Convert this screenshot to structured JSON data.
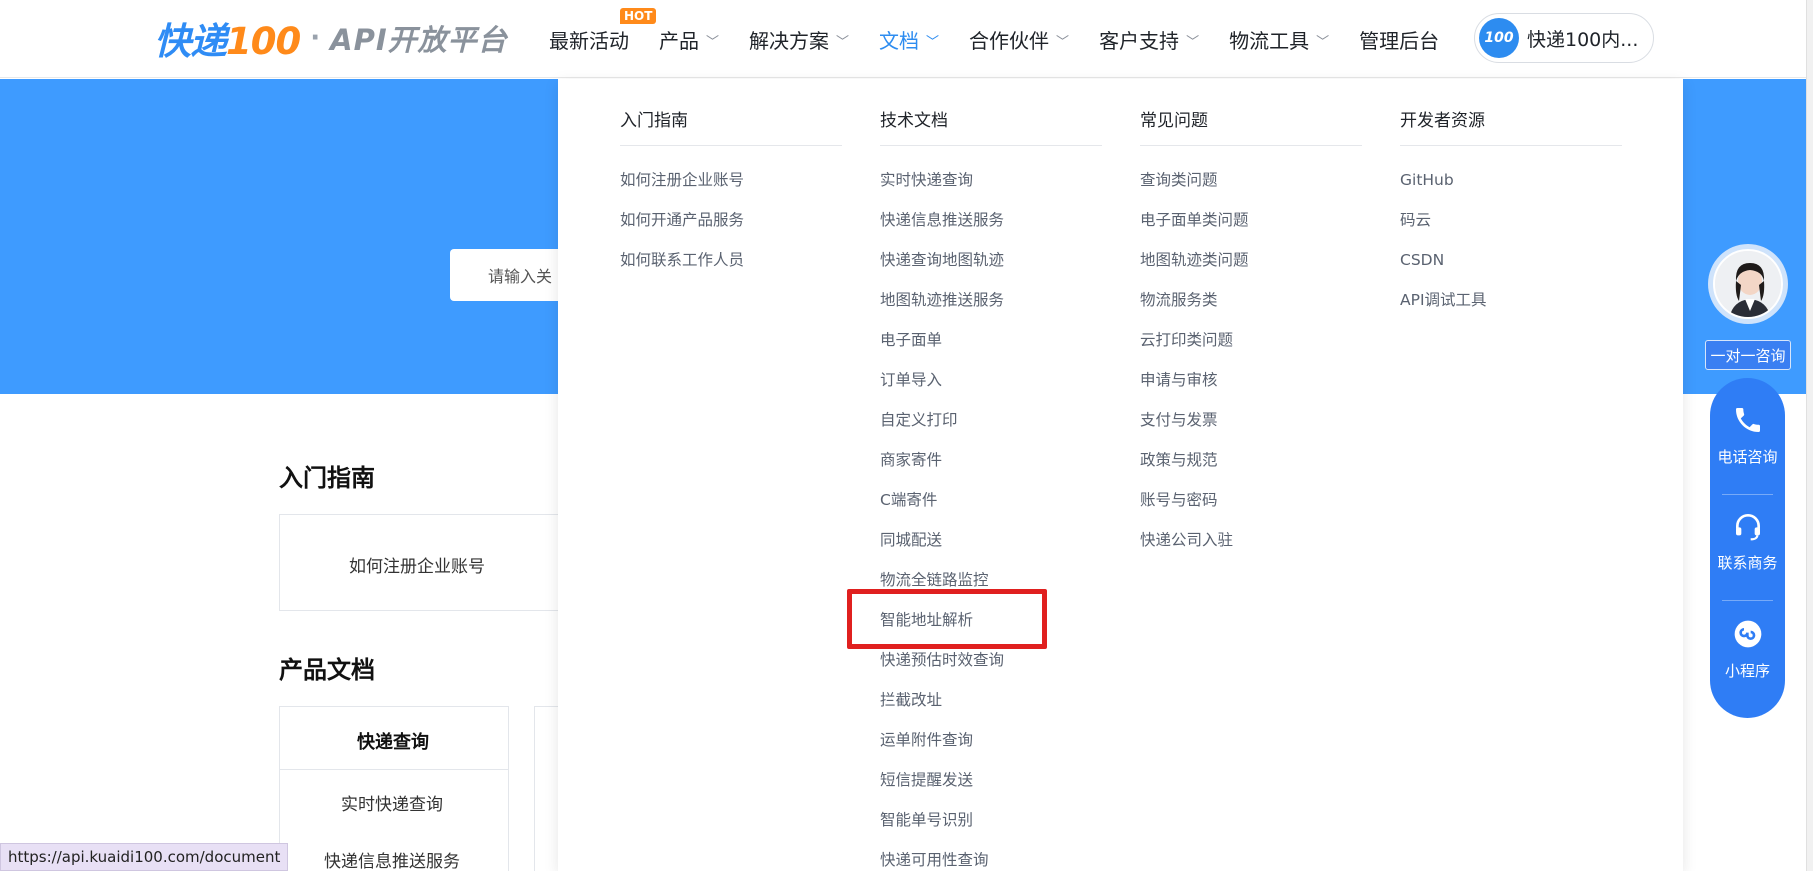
{
  "logo": {
    "brand_text": "快递",
    "brand_num": "100",
    "dot": "·",
    "subtitle": "API开放平台"
  },
  "nav": {
    "items": [
      {
        "label": "最新活动",
        "badge": "HOT"
      },
      {
        "label": "产品"
      },
      {
        "label": "解决方案"
      },
      {
        "label": "文档"
      },
      {
        "label": "合作伙伴"
      },
      {
        "label": "客户支持"
      },
      {
        "label": "物流工具"
      },
      {
        "label": "管理后台"
      }
    ],
    "active_index": 3
  },
  "account": {
    "logo_text": "100",
    "name": "快递100内..."
  },
  "search": {
    "placeholder": "请输入关"
  },
  "sections": {
    "intro_title": "入门指南",
    "intro_card_item": "如何注册企业账号",
    "product_title": "产品文档",
    "table_header": "快递查询",
    "table_rows": [
      "实时快递查询",
      "快递信息推送服务"
    ]
  },
  "status_url": "https://api.kuaidi100.com/document",
  "dropdown": {
    "columns": [
      {
        "title": "入门指南",
        "items": [
          "如何注册企业账号",
          "如何开通产品服务",
          "如何联系工作人员"
        ]
      },
      {
        "title": "技术文档",
        "items": [
          "实时快递查询",
          "快递信息推送服务",
          "快递查询地图轨迹",
          "地图轨迹推送服务",
          "电子面单",
          "订单导入",
          "自定义打印",
          "商家寄件",
          "C端寄件",
          "同城配送",
          "物流全链路监控",
          "智能地址解析",
          "快递预估时效查询",
          "拦截改址",
          "运单附件查询",
          "短信提醒发送",
          "智能单号识别",
          "快递可用性查询"
        ]
      },
      {
        "title": "常见问题",
        "items": [
          "查询类问题",
          "电子面单类问题",
          "地图轨迹类问题",
          "物流服务类",
          "云打印类问题",
          "申请与审核",
          "支付与发票",
          "政策与规范",
          "账号与密码",
          "快递公司入驻"
        ]
      },
      {
        "title": "开发者资源",
        "items": [
          "GitHub",
          "码云",
          "CSDN",
          "API调试工具"
        ]
      }
    ]
  },
  "side": {
    "consult_label": "一对一咨询",
    "phone_label": "电话咨询",
    "biz_label": "联系商务",
    "mini_label": "小程序"
  },
  "colors": {
    "brand_blue": "#2d8cf0",
    "banner_blue": "#3e9bff",
    "hot_orange": "#ff8a1a",
    "highlight_red": "#e0201f"
  }
}
